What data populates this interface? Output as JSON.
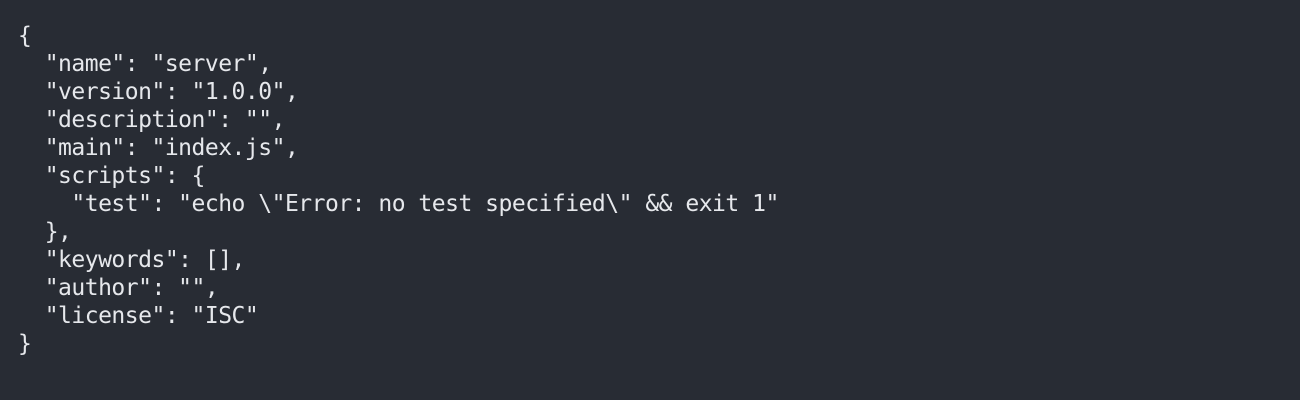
{
  "terminal": {
    "background": "#282c34",
    "text_color": "#e6e8ec",
    "lines": [
      "{",
      "  \"name\": \"server\",",
      "  \"version\": \"1.0.0\",",
      "  \"description\": \"\",",
      "  \"main\": \"index.js\",",
      "  \"scripts\": {",
      "    \"test\": \"echo \\\"Error: no test specified\\\" && exit 1\"",
      "  },",
      "  \"keywords\": [],",
      "  \"author\": \"\",",
      "  \"license\": \"ISC\"",
      "}"
    ]
  }
}
